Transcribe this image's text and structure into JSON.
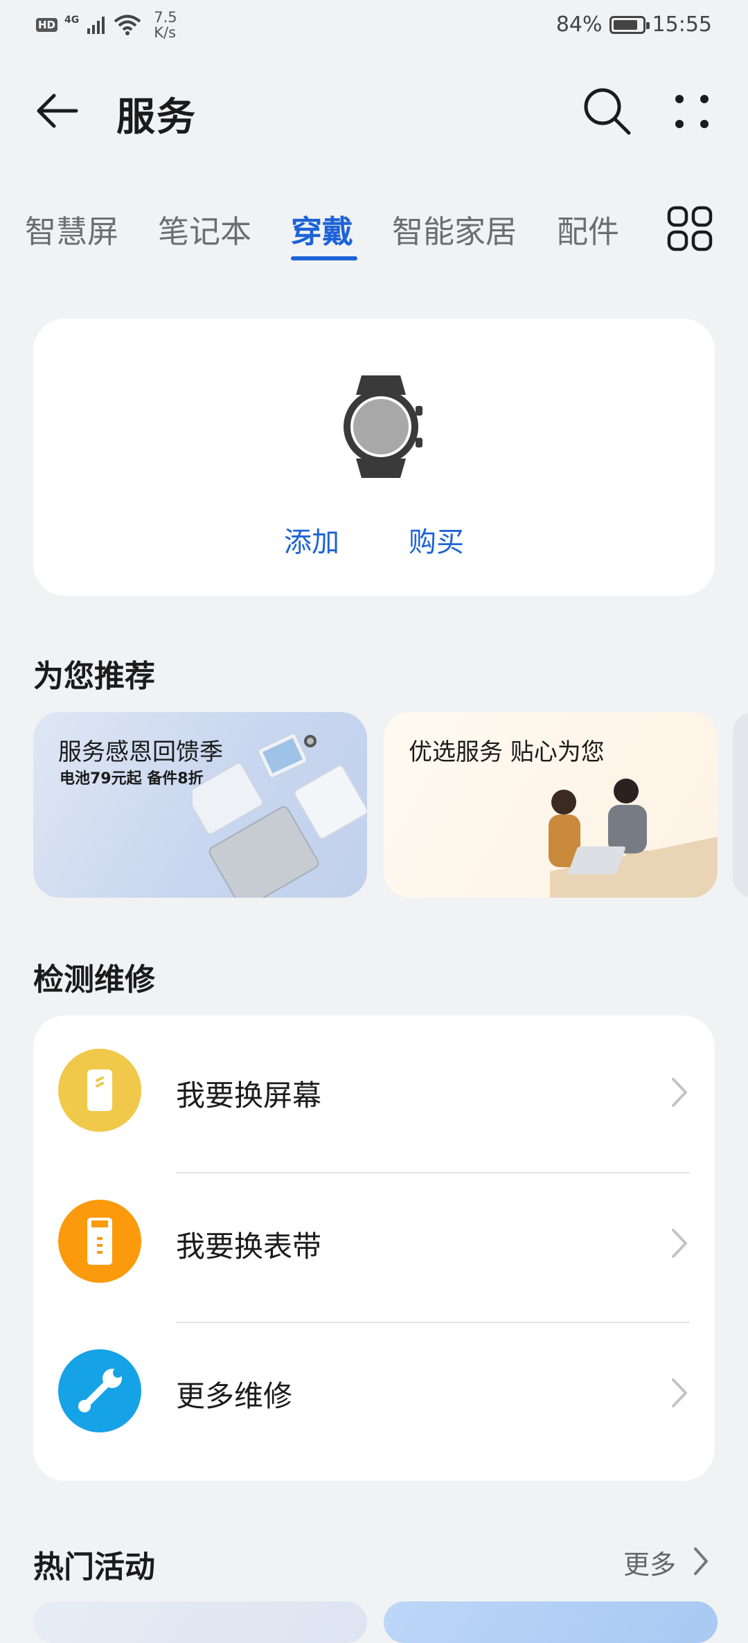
{
  "status_bar": {
    "hd": "HD",
    "network": "4G",
    "speed_value": "7.5",
    "speed_unit": "K/s",
    "battery": "84%",
    "time": "15:55"
  },
  "header": {
    "title": "服务"
  },
  "tabs": [
    {
      "label": "智慧屏"
    },
    {
      "label": "笔记本"
    },
    {
      "label": "穿戴",
      "active": true
    },
    {
      "label": "智能家居"
    },
    {
      "label": "配件"
    }
  ],
  "device_card": {
    "add_label": "添加",
    "buy_label": "购买"
  },
  "recommend": {
    "title": "为您推荐",
    "banners": [
      {
        "title": "服务感恩回馈季",
        "subtitle": "电池79元起 备件8折"
      },
      {
        "title": "优选服务 贴心为您"
      }
    ]
  },
  "repair": {
    "title": "检测维修",
    "items": [
      {
        "label": "我要换屏幕",
        "icon": "phone-screen-icon",
        "color": "#f0c94a"
      },
      {
        "label": "我要换表带",
        "icon": "watch-strap-icon",
        "color": "#fb9a0c"
      },
      {
        "label": "更多维修",
        "icon": "wrench-icon",
        "color": "#15a2e6"
      }
    ]
  },
  "hot": {
    "title": "热门活动",
    "more_label": "更多"
  },
  "colors": {
    "accent": "#1d63d8",
    "background": "#f1f2f4"
  }
}
